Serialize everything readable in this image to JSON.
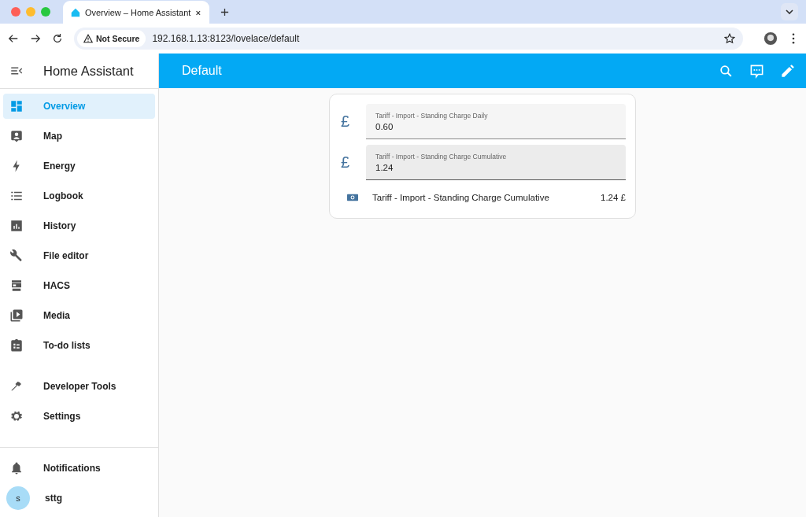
{
  "browser": {
    "tab_title": "Overview – Home Assistant",
    "security": "Not Secure",
    "url": "192.168.1.13:8123/lovelace/default"
  },
  "sidebar": {
    "title": "Home Assistant",
    "items": [
      {
        "label": "Overview",
        "selected": true
      },
      {
        "label": "Map",
        "selected": false
      },
      {
        "label": "Energy",
        "selected": false
      },
      {
        "label": "Logbook",
        "selected": false
      },
      {
        "label": "History",
        "selected": false
      },
      {
        "label": "File editor",
        "selected": false
      },
      {
        "label": "HACS",
        "selected": false
      },
      {
        "label": "Media",
        "selected": false
      },
      {
        "label": "To-do lists",
        "selected": false
      }
    ],
    "tools": [
      {
        "label": "Developer Tools",
        "selected": false
      },
      {
        "label": "Settings",
        "selected": false
      }
    ],
    "notifications": "Notifications",
    "user": {
      "initial": "s",
      "name": "sttg"
    }
  },
  "header": {
    "title": "Default"
  },
  "card": {
    "rows": [
      {
        "kind": "input",
        "symbol": "£",
        "label": "Tariff - Import - Standing Charge Daily",
        "value": "0.60",
        "hovered": false
      },
      {
        "kind": "input",
        "symbol": "£",
        "label": "Tariff - Import - Standing Charge Cumulative",
        "value": "1.24",
        "hovered": true
      },
      {
        "kind": "entity",
        "name": "Tariff - Import - Standing Charge Cumulative",
        "value": "1.24 £"
      }
    ]
  }
}
